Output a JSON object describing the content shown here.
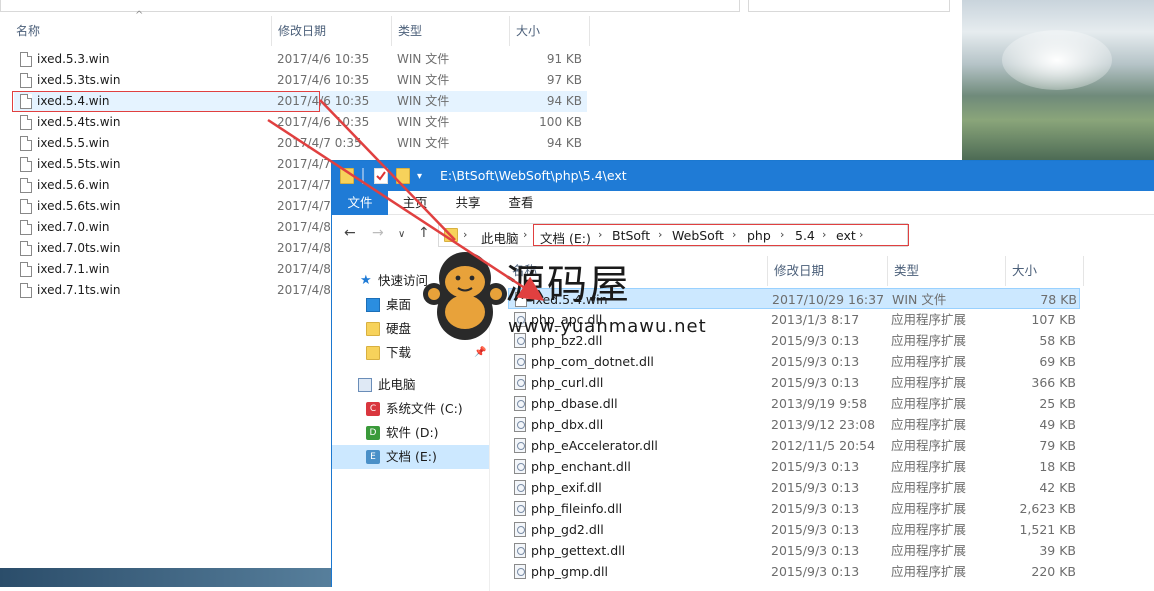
{
  "background_window": {
    "columns": {
      "name": "名称",
      "date": "修改日期",
      "type": "类型",
      "size": "大小"
    },
    "files": [
      {
        "name": "ixed.5.3.win",
        "date": "2017/4/6 10:35",
        "type": "WIN 文件",
        "size": "91 KB"
      },
      {
        "name": "ixed.5.3ts.win",
        "date": "2017/4/6 10:35",
        "type": "WIN 文件",
        "size": "97 KB"
      },
      {
        "name": "ixed.5.4.win",
        "date": "2017/4/6 10:35",
        "type": "WIN 文件",
        "size": "94 KB"
      },
      {
        "name": "ixed.5.4ts.win",
        "date": "2017/4/6 10:35",
        "type": "WIN 文件",
        "size": "100 KB"
      },
      {
        "name": "ixed.5.5.win",
        "date": "2017/4/7 0:35",
        "type": "WIN 文件",
        "size": "94 KB"
      },
      {
        "name": "ixed.5.5ts.win",
        "date": "2017/4/7",
        "type": "",
        "size": ""
      },
      {
        "name": "ixed.5.6.win",
        "date": "2017/4/7",
        "type": "",
        "size": ""
      },
      {
        "name": "ixed.5.6ts.win",
        "date": "2017/4/7",
        "type": "",
        "size": ""
      },
      {
        "name": "ixed.7.0.win",
        "date": "2017/4/8",
        "type": "",
        "size": ""
      },
      {
        "name": "ixed.7.0ts.win",
        "date": "2017/4/8",
        "type": "",
        "size": ""
      },
      {
        "name": "ixed.7.1.win",
        "date": "2017/4/8",
        "type": "",
        "size": ""
      },
      {
        "name": "ixed.7.1ts.win",
        "date": "2017/4/8",
        "type": "",
        "size": ""
      }
    ]
  },
  "explorer": {
    "title": "E:\\BtSoft\\WebSoft\\php\\5.4\\ext",
    "ribbon_tabs": [
      "文件",
      "主页",
      "共享",
      "查看"
    ],
    "breadcrumb": [
      "此电脑",
      "文档 (E:)",
      "BtSoft",
      "WebSoft",
      "php",
      "5.4",
      "ext"
    ],
    "nav": {
      "quick_access": "快速访问",
      "desktop": "桌面",
      "hdd": "硬盘",
      "downloads": "下载",
      "this_pc": "此电脑",
      "drive_c": "系统文件 (C:)",
      "drive_d": "软件 (D:)",
      "drive_e": "文档 (E:)"
    },
    "columns": {
      "name": "名称",
      "date": "修改日期",
      "type": "类型",
      "size": "大小"
    },
    "files": [
      {
        "name": "ixed.5.4.win",
        "date": "2017/10/29 16:37",
        "type": "WIN 文件",
        "size": "78 KB"
      },
      {
        "name": "php_apc.dll",
        "date": "2013/1/3 8:17",
        "type": "应用程序扩展",
        "size": "107 KB"
      },
      {
        "name": "php_bz2.dll",
        "date": "2015/9/3 0:13",
        "type": "应用程序扩展",
        "size": "58 KB"
      },
      {
        "name": "php_com_dotnet.dll",
        "date": "2015/9/3 0:13",
        "type": "应用程序扩展",
        "size": "69 KB"
      },
      {
        "name": "php_curl.dll",
        "date": "2015/9/3 0:13",
        "type": "应用程序扩展",
        "size": "366 KB"
      },
      {
        "name": "php_dbase.dll",
        "date": "2013/9/19 9:58",
        "type": "应用程序扩展",
        "size": "25 KB"
      },
      {
        "name": "php_dbx.dll",
        "date": "2013/9/12 23:08",
        "type": "应用程序扩展",
        "size": "49 KB"
      },
      {
        "name": "php_eAccelerator.dll",
        "date": "2012/11/5 20:54",
        "type": "应用程序扩展",
        "size": "79 KB"
      },
      {
        "name": "php_enchant.dll",
        "date": "2015/9/3 0:13",
        "type": "应用程序扩展",
        "size": "18 KB"
      },
      {
        "name": "php_exif.dll",
        "date": "2015/9/3 0:13",
        "type": "应用程序扩展",
        "size": "42 KB"
      },
      {
        "name": "php_fileinfo.dll",
        "date": "2015/9/3 0:13",
        "type": "应用程序扩展",
        "size": "2,623 KB"
      },
      {
        "name": "php_gd2.dll",
        "date": "2015/9/3 0:13",
        "type": "应用程序扩展",
        "size": "1,521 KB"
      },
      {
        "name": "php_gettext.dll",
        "date": "2015/9/3 0:13",
        "type": "应用程序扩展",
        "size": "39 KB"
      },
      {
        "name": "php_gmp.dll",
        "date": "2015/9/3 0:13",
        "type": "应用程序扩展",
        "size": "220 KB"
      }
    ]
  },
  "watermark": {
    "title": "源码屋",
    "url": "www.yuanmawu.net"
  },
  "colors": {
    "accent": "#1f7bd6",
    "highlight_box": "#e04040",
    "selection": "#cce8ff"
  }
}
